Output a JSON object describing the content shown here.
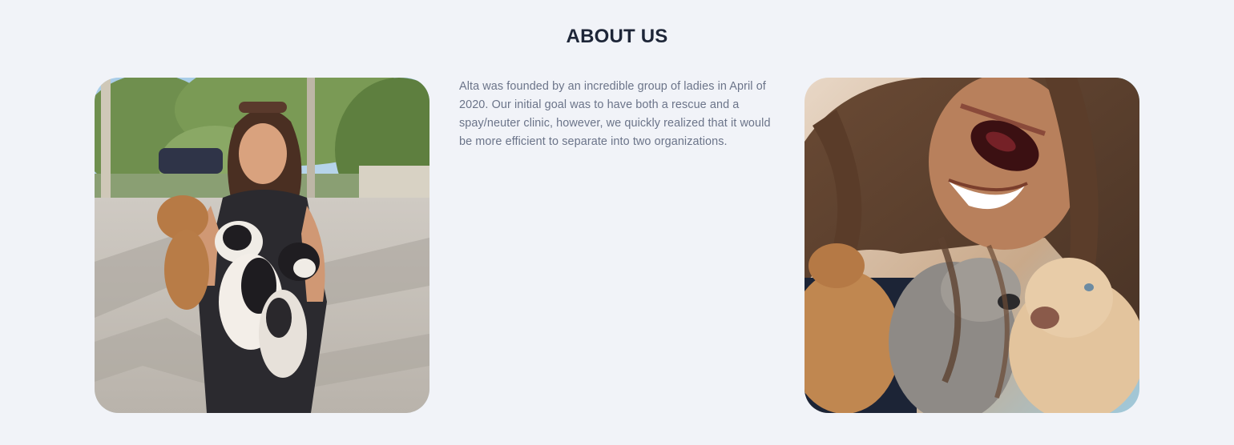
{
  "about": {
    "title": "ABOUT US",
    "body": "Alta was founded by an incredible group of ladies in April of 2020. Our initial goal was to have both a rescue and a spay/neuter clinic, however, we quickly realized that it would be more efficient to separate into two organizations.",
    "images": [
      {
        "subject": "woman-holding-puppies-photo"
      },
      {
        "subject": "woman-hugging-puppies-photo"
      }
    ]
  }
}
